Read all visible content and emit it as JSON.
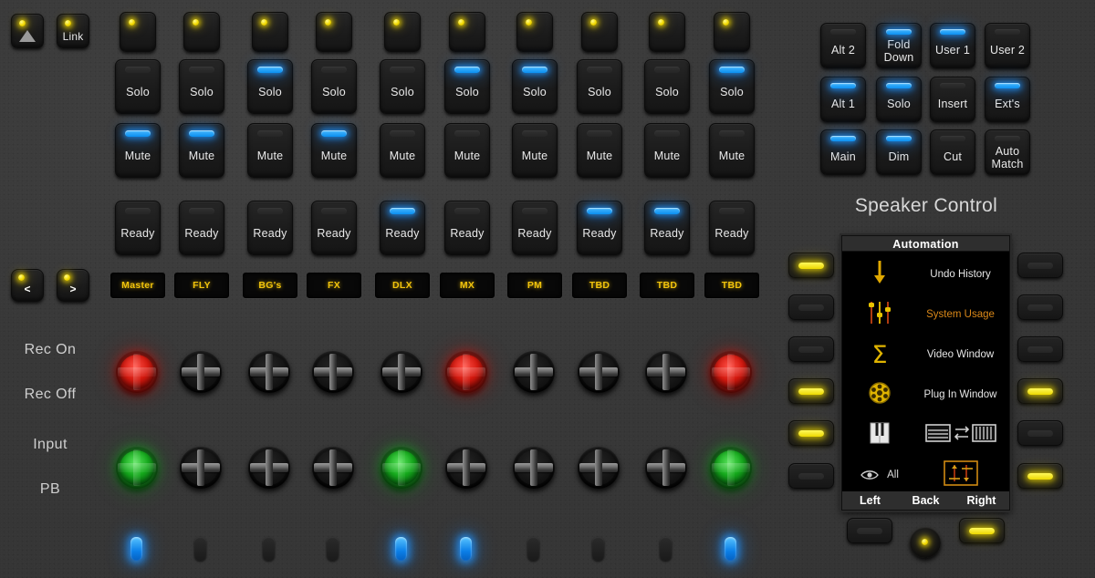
{
  "device": {
    "title": "Speaker Control",
    "colors": {
      "panel": "#3a3a3a",
      "led_blue": "#1f96ff",
      "led_yellow": "#ecd800",
      "led_red": "#d41a10",
      "led_green": "#15a81c",
      "strip_text": "#f2c40c",
      "lcd_amber": "#d98718"
    }
  },
  "global_buttons": [
    {
      "name": "monitor-up-button",
      "icon": "triangle-up-icon",
      "label": "",
      "led": "yellow"
    },
    {
      "name": "link-button",
      "icon": "",
      "label": "Link",
      "led": "yellow"
    }
  ],
  "nav_buttons": [
    {
      "name": "bank-left-button",
      "label": "<",
      "led": "yellow"
    },
    {
      "name": "bank-right-button",
      "label": ">",
      "led": "yellow"
    }
  ],
  "row_labels": [
    "Rec On",
    "Rec Off",
    "Input",
    "PB"
  ],
  "channels": {
    "select_label": "",
    "solo_label": "Solo",
    "mute_label": "Mute",
    "ready_label": "Ready",
    "strips": [
      {
        "name": "Master",
        "select_led": "yellow",
        "solo": false,
        "mute": true,
        "ready": false,
        "rec_knob": "red",
        "input_knob": "green",
        "pill": true
      },
      {
        "name": "FLY",
        "select_led": "yellow",
        "solo": false,
        "mute": true,
        "ready": false,
        "rec_knob": "dark",
        "input_knob": "dark",
        "pill": false
      },
      {
        "name": "BG's",
        "select_led": "yellow",
        "solo": true,
        "mute": false,
        "ready": false,
        "rec_knob": "dark",
        "input_knob": "dark",
        "pill": false
      },
      {
        "name": "FX",
        "select_led": "yellow",
        "solo": false,
        "mute": true,
        "ready": false,
        "rec_knob": "dark",
        "input_knob": "dark",
        "pill": false
      },
      {
        "name": "DLX",
        "select_led": "yellow",
        "solo": false,
        "mute": false,
        "ready": true,
        "rec_knob": "dark",
        "input_knob": "green",
        "pill": true
      },
      {
        "name": "MX",
        "select_led": "yellow",
        "solo": true,
        "mute": false,
        "ready": false,
        "rec_knob": "red",
        "input_knob": "dark",
        "pill": true
      },
      {
        "name": "PM",
        "select_led": "yellow",
        "solo": true,
        "mute": false,
        "ready": false,
        "rec_knob": "dark",
        "input_knob": "dark",
        "pill": false
      },
      {
        "name": "TBD",
        "select_led": "yellow",
        "solo": false,
        "mute": false,
        "ready": true,
        "rec_knob": "dark",
        "input_knob": "dark",
        "pill": false
      },
      {
        "name": "TBD",
        "select_led": "yellow",
        "solo": false,
        "mute": false,
        "ready": true,
        "rec_knob": "dark",
        "input_knob": "dark",
        "pill": false
      },
      {
        "name": "TBD",
        "select_led": "yellow",
        "solo": true,
        "mute": false,
        "ready": false,
        "rec_knob": "red",
        "input_knob": "green",
        "pill": true
      }
    ]
  },
  "speaker_control": {
    "heading": "Speaker Control",
    "buttons": [
      {
        "label": "Alt 2",
        "led": "off"
      },
      {
        "label": "Fold Down",
        "led": "blue"
      },
      {
        "label": "User 1",
        "led": "blue"
      },
      {
        "label": "User 2",
        "led": "off"
      },
      {
        "label": "Alt 1",
        "led": "blue"
      },
      {
        "label": "Solo",
        "led": "blue"
      },
      {
        "label": "Insert",
        "led": "off"
      },
      {
        "label": "Ext's",
        "led": "blue"
      },
      {
        "label": "Main",
        "led": "blue"
      },
      {
        "label": "Dim",
        "led": "blue"
      },
      {
        "label": "Cut",
        "led": "off"
      },
      {
        "label": "Auto Match",
        "led": "off"
      }
    ]
  },
  "lcd": {
    "title": "Automation",
    "rows": [
      {
        "icon": "down-arrow-icon",
        "text": "Undo History",
        "highlight": false
      },
      {
        "icon": "faders-icon",
        "text": "System Usage",
        "highlight": true
      },
      {
        "icon": "sigma-icon",
        "text": "Video Window",
        "highlight": false
      },
      {
        "icon": "film-reel-icon",
        "text": "Plug In Window",
        "highlight": false
      },
      {
        "icon": "keyboard-icon",
        "text": "",
        "highlight": false
      },
      {
        "icon": "eye-icon",
        "text": "",
        "highlight": false
      }
    ],
    "row5_right_icon": "window-swap-icon",
    "row6_left_label": "All",
    "row6_right_icon": "fader-range-icon",
    "footer": [
      "Left",
      "Back",
      "Right"
    ]
  },
  "soft_keys": {
    "left": [
      "yellow",
      "off",
      "off",
      "yellow",
      "yellow",
      "off"
    ],
    "right": [
      "off",
      "off",
      "off",
      "yellow",
      "off",
      "yellow"
    ],
    "bottom_left": "off",
    "bottom_right": "yellow",
    "bottom_knob_led": "yellow"
  }
}
